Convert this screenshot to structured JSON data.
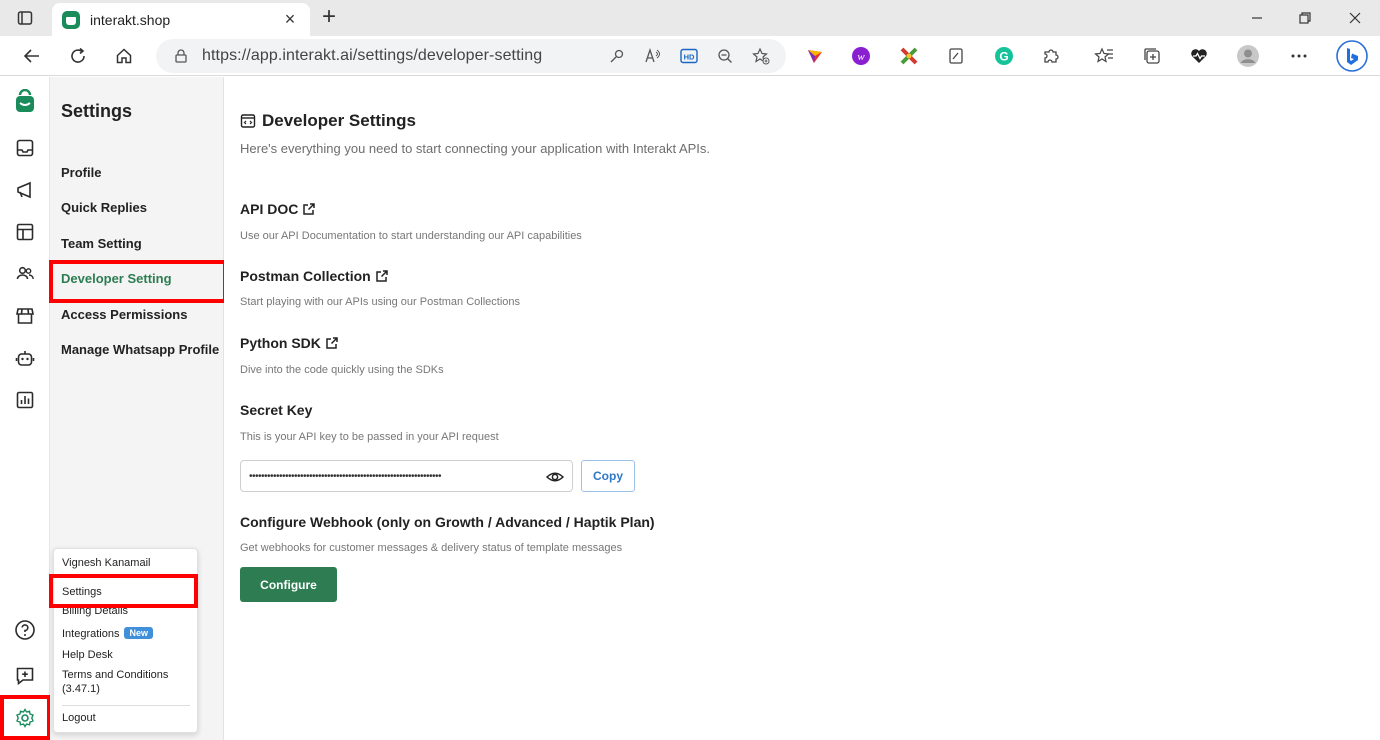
{
  "browser": {
    "tab_title": "interakt.shop",
    "tab_close": "×",
    "new_tab": "+",
    "url": "https://app.interakt.ai/settings/developer-setting",
    "window_controls": {
      "minimize": "—",
      "restore": "❐",
      "close": "✕"
    }
  },
  "settings_sidebar": {
    "title": "Settings",
    "items": [
      {
        "label": "Profile"
      },
      {
        "label": "Quick Replies"
      },
      {
        "label": "Team Setting"
      },
      {
        "label": "Developer Setting",
        "active": true
      },
      {
        "label": "Access Permissions"
      },
      {
        "label": "Manage Whatsapp Profile"
      }
    ]
  },
  "main": {
    "title": "Developer Settings",
    "subtitle": "Here's everything you need to start connecting your application with Interakt APIs.",
    "sections": [
      {
        "title": "API DOC",
        "desc": "Use our API Documentation to start understanding our API capabilities"
      },
      {
        "title": "Postman Collection",
        "desc": "Start playing with our APIs using our Postman Collections"
      },
      {
        "title": "Python SDK",
        "desc": "Dive into the code quickly using the SDKs"
      },
      {
        "title": "Secret Key",
        "desc": "This is your API key to be passed in your API request"
      },
      {
        "title": "Configure Webhook (only on Growth / Advanced / Haptik Plan)",
        "desc": "Get webhooks for customer messages & delivery status of template messages"
      }
    ],
    "secret_key_masked": "••••••••••••••••••••••••••••••••••••••••••••••••••••••••••••••••",
    "copy_label": "Copy",
    "configure_label": "Configure"
  },
  "account_popup": {
    "user_name": "Vignesh Kanamail",
    "settings": "Settings",
    "billing": "Billing Details",
    "integrations": "Integrations",
    "integrations_badge": "New",
    "help_desk": "Help Desk",
    "terms": "Terms and Conditions",
    "version": "(3.47.1)",
    "logout": "Logout"
  },
  "colors": {
    "brand_green": "#2e7d52",
    "link_blue": "#2e77c9",
    "highlight_red": "#ff0000"
  }
}
